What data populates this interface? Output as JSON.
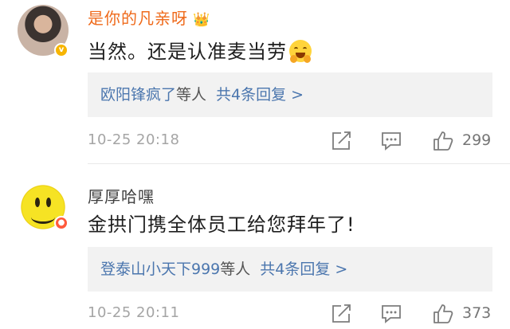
{
  "comments": [
    {
      "username": "是你的凡亲呀",
      "content": "当然。还是认准麦当劳",
      "replies": {
        "names": "欧阳锋疯了",
        "suffix": "等人",
        "more": "共4条回复 >"
      },
      "timestamp": "10-25 20:18",
      "likes": "299"
    },
    {
      "username": "厚厚哈嘿",
      "content": "金拱门携全体员工给您拜年了!",
      "replies": {
        "names": "登泰山小天下999",
        "suffix": "等人",
        "more": "共4条回复 >"
      },
      "timestamp": "10-25 20:11",
      "likes": "373"
    }
  ],
  "icons": [
    "avatar-verified-icon",
    "crown-icon",
    "hugging-emoji-icon",
    "share-icon",
    "reply-icon",
    "like-icon"
  ],
  "colors": {
    "gold_username": "#ef6a1b",
    "reply_link": "#4b76ae",
    "reply_bg": "#f2f2f2",
    "meta": "#a5a5a5"
  }
}
